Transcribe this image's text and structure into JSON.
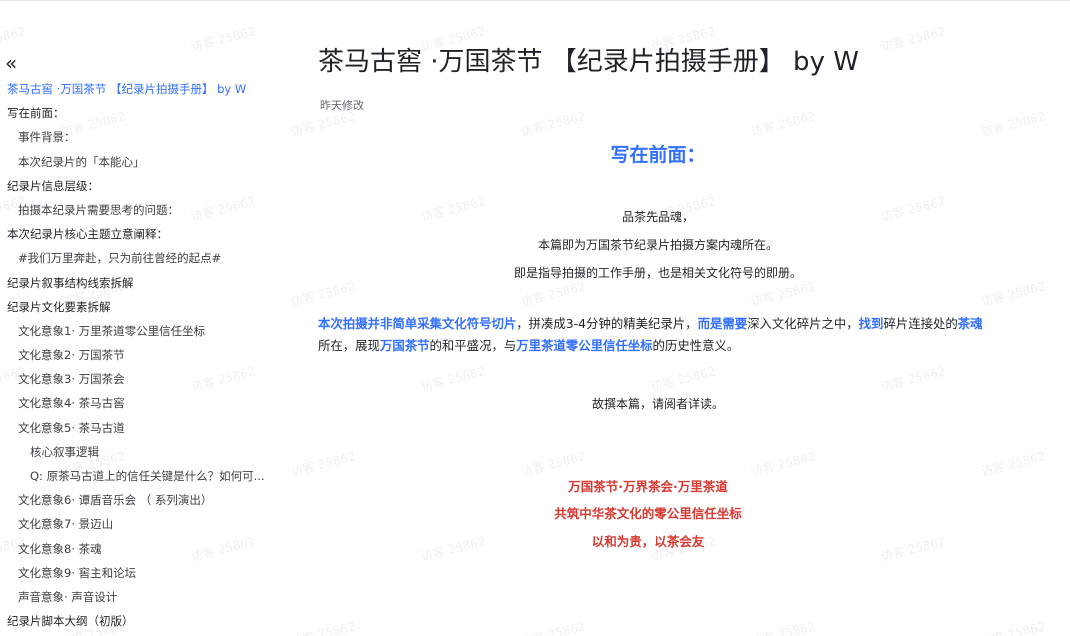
{
  "sidebar": {
    "collapse_icon": "double-chevron-left-icon",
    "items": [
      {
        "label": "茶马古窖 ·万国茶节 【纪录片拍摄手册】 by W",
        "level": 1,
        "active": true
      },
      {
        "label": "写在前面：",
        "level": 1
      },
      {
        "label": "事件背景：",
        "level": 2
      },
      {
        "label": "本次纪录片的「本能心」",
        "level": 2
      },
      {
        "label": "纪录片信息层级：",
        "level": 1
      },
      {
        "label": "拍摄本纪录片需要思考的问题：",
        "level": 2
      },
      {
        "label": "本次纪录片核心主题立意阐释：",
        "level": 1
      },
      {
        "label": "#我们万里奔赴，只为前往曾经的起点#",
        "level": 2
      },
      {
        "label": "纪录片叙事结构线索拆解",
        "level": 1
      },
      {
        "label": "纪录片文化要素拆解",
        "level": 1
      },
      {
        "label": "文化意象1· 万里茶道零公里信任坐标",
        "level": 2
      },
      {
        "label": "文化意象2· 万国茶节",
        "level": 2
      },
      {
        "label": "文化意象3· 万国茶会",
        "level": 2
      },
      {
        "label": "文化意象4· 茶马古窖",
        "level": 2
      },
      {
        "label": "文化意象5· 茶马古道",
        "level": 2
      },
      {
        "label": "核心叙事逻辑",
        "level": 3
      },
      {
        "label": "Q: 原茶马古道上的信任关键是什么？如何可...",
        "level": 3
      },
      {
        "label": "文化意象6· 谭盾音乐会 （ 系列演出）",
        "level": 2
      },
      {
        "label": "文化意象7· 景迈山",
        "level": 2
      },
      {
        "label": "文化意象8· 茶魂",
        "level": 2
      },
      {
        "label": "文化意象9· 窖主和论坛",
        "level": 2
      },
      {
        "label": "声音意象· 声音设计",
        "level": 2
      },
      {
        "label": "纪录片脚本大纲（初版）",
        "level": 1
      }
    ]
  },
  "document": {
    "title": "茶马古窖 ·万国茶节 【纪录片拍摄手册】 by W",
    "modified": "昨天修改",
    "section_heading": "写在前面：",
    "intro_lines": [
      "品茶先品魂，",
      "本篇即为万国茶节纪录片拍摄方案内魂所在。",
      "即是指导拍摄的工作手册，也是相关文化符号的即册。"
    ],
    "paragraph_runs": [
      {
        "text": "本次拍摄并非简单采集文化符号切片",
        "highlight": true
      },
      {
        "text": "，拼凑成3-4分钟的精美纪录片，",
        "highlight": false
      },
      {
        "text": "而是需要",
        "highlight": true
      },
      {
        "text": "深入文化碎片之中，",
        "highlight": false
      },
      {
        "text": "找到",
        "highlight": true
      },
      {
        "text": "碎片连接处的",
        "highlight": false
      },
      {
        "text": "茶魂",
        "highlight": true
      },
      {
        "text": "所在，展现",
        "highlight": false
      },
      {
        "text": "万国茶节",
        "highlight": true
      },
      {
        "text": "的和平盛况，与",
        "highlight": false
      },
      {
        "text": "万里茶道零公里信任坐标",
        "highlight": true
      },
      {
        "text": "的历史性意义。",
        "highlight": false
      }
    ],
    "closing": "故撰本篇，请阅者详读。",
    "slogans": [
      "万国茶节·万界茶会·万里茶道",
      "共筑中华茶文化的零公里信任坐标",
      "以和为贵，以茶会友"
    ]
  },
  "watermark": {
    "text": "访客 25862"
  },
  "colors": {
    "accent": "#3370ff",
    "slogan_red": "#d83931",
    "text": "#1f2329",
    "muted": "#646a73"
  }
}
